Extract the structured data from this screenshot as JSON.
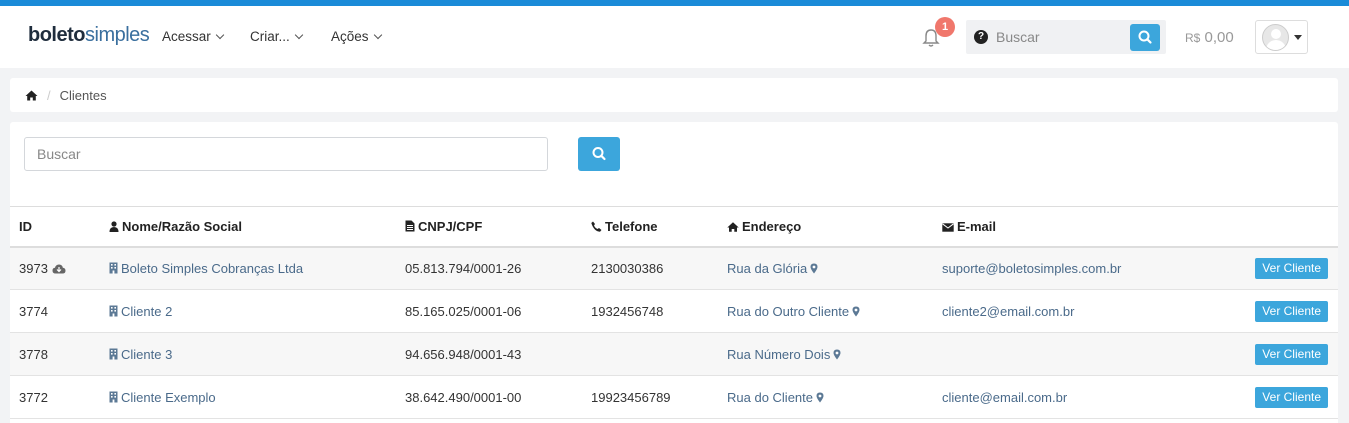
{
  "brand": {
    "logo_bold": "boleto",
    "logo_light": "simples"
  },
  "nav": [
    {
      "label": "Acessar"
    },
    {
      "label": "Criar..."
    },
    {
      "label": "Ações"
    }
  ],
  "notifications": {
    "count": "1"
  },
  "top_search": {
    "placeholder": "Buscar",
    "help_icon": "question-circle-icon",
    "button_icon": "search-icon"
  },
  "balance": {
    "currency": "R$",
    "amount": "0,00"
  },
  "breadcrumb": {
    "home_icon": "home-icon",
    "current": "Clientes"
  },
  "list_search": {
    "placeholder": "Buscar"
  },
  "table": {
    "headers": {
      "id": "ID",
      "name": "Nome/Razão Social",
      "doc": "CNPJ/CPF",
      "phone": "Telefone",
      "address": "Endereço",
      "email": "E-mail"
    },
    "rows": [
      {
        "id": "3973",
        "name": "Boleto Simples Cobranças Ltda",
        "doc": "05.813.794/0001-26",
        "phone": "2130030386",
        "address": "Rua da Glória",
        "email": "suporte@boletosimples.com.br",
        "action": "Ver Cliente"
      },
      {
        "id": "3774",
        "name": "Cliente 2",
        "doc": "85.165.025/0001-06",
        "phone": "1932456748",
        "address": "Rua do Outro Cliente",
        "email": "cliente2@email.com.br",
        "action": "Ver Cliente"
      },
      {
        "id": "3778",
        "name": "Cliente 3",
        "doc": "94.656.948/0001-43",
        "phone": "",
        "address": "Rua Número Dois",
        "email": "",
        "action": "Ver Cliente"
      },
      {
        "id": "3772",
        "name": "Cliente Exemplo",
        "doc": "38.642.490/0001-00",
        "phone": "19923456789",
        "address": "Rua do Cliente",
        "email": "cliente@email.com.br",
        "action": "Ver Cliente"
      }
    ]
  },
  "colors": {
    "accent": "#3ca6dc",
    "topbar": "#1a8bd8",
    "badge": "#f0776c"
  }
}
